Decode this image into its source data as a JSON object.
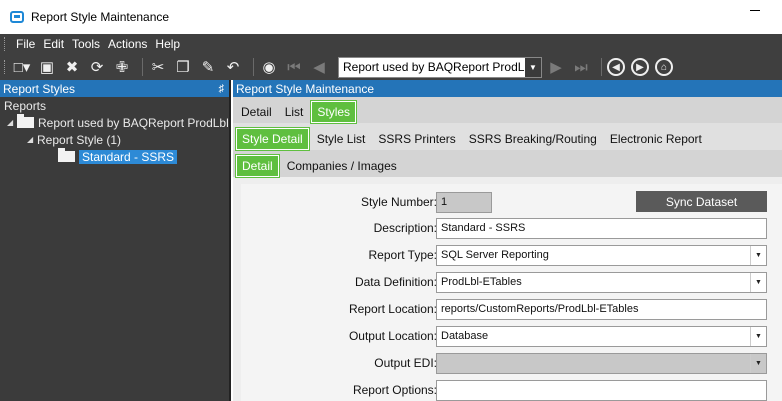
{
  "window": {
    "title": "Report Style Maintenance"
  },
  "menu": [
    "File",
    "Edit",
    "Tools",
    "Actions",
    "Help"
  ],
  "toolbar": {
    "report_selector_value": "Report used by BAQReport ProdL",
    "icons": [
      "new-icon",
      "save-icon",
      "delete-icon",
      "refresh-icon",
      "clear-icon",
      "cut-icon",
      "copy-icon",
      "paste-icon",
      "undo-icon",
      "search-icon",
      "first-icon",
      "prev-icon",
      "next-icon",
      "last-icon",
      "back-icon",
      "forward-icon",
      "home-icon"
    ]
  },
  "left_panel": {
    "title": "Report Styles",
    "tree": {
      "root": "Reports",
      "report": "Report used by BAQReport ProdLbl",
      "style_group": "Report Style (1)",
      "selected_item": "Standard - SSRS"
    }
  },
  "main": {
    "title": "Report Style Maintenance",
    "tabs_top": [
      "Detail",
      "List",
      "Styles"
    ],
    "tabs_style": [
      "Style Detail",
      "Style List",
      "SSRS Printers",
      "SSRS Breaking/Routing",
      "Electronic Report"
    ],
    "tabs_sub": [
      "Detail",
      "Companies / Images"
    ],
    "form": {
      "style_number_label": "Style Number:",
      "style_number_value": "1",
      "sync_button": "Sync Dataset",
      "description_label": "Description:",
      "description_value": "Standard - SSRS",
      "report_type_label": "Report Type:",
      "report_type_value": "SQL Server Reporting",
      "data_definition_label": "Data Definition:",
      "data_definition_value": "ProdLbl-ETables",
      "report_location_label": "Report Location:",
      "report_location_value": "reports/CustomReports/ProdLbl-ETables",
      "output_location_label": "Output Location:",
      "output_location_value": "Database",
      "output_edi_label": "Output EDI:",
      "output_edi_value": "",
      "report_options_label": "Report Options:",
      "report_options_value": ""
    }
  },
  "colors": {
    "header_blue": "#2474b8",
    "active_tab_green": "#5fbf3f",
    "dark_bg": "#3f3f3f"
  }
}
